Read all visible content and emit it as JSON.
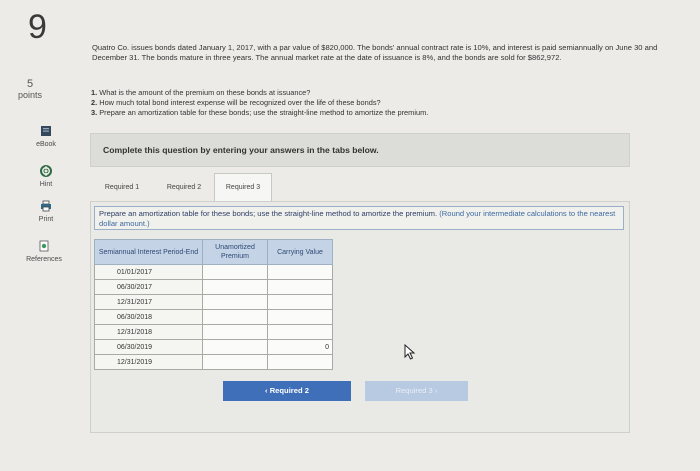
{
  "question_number": "9",
  "points": {
    "value": "5",
    "label": "points"
  },
  "tools": [
    {
      "name": "ebook",
      "label": "eBook",
      "icon": "book-icon"
    },
    {
      "name": "hint",
      "label": "Hint",
      "icon": "lifebuoy-icon"
    },
    {
      "name": "print",
      "label": "Print",
      "icon": "printer-icon"
    },
    {
      "name": "references",
      "label": "References",
      "icon": "references-icon"
    }
  ],
  "problem": {
    "text": "Quatro Co. issues bonds dated January 1, 2017, with a par value of $820,000. The bonds' annual contract rate is 10%, and interest is paid semiannually on June 30 and December 31. The bonds mature in three years. The annual market rate at the date of issuance is 8%, and the bonds are sold for $862,972.",
    "questions": [
      {
        "num": "1.",
        "text": "What is the amount of the premium on these bonds at issuance?"
      },
      {
        "num": "2.",
        "text": "How much total bond interest expense will be recognized over the life of these bonds?"
      },
      {
        "num": "3.",
        "text": "Prepare an amortization table for these bonds; use the straight-line method to amortize the premium."
      }
    ]
  },
  "banner": "Complete this question by entering your answers in the tabs below.",
  "tabs": [
    {
      "label": "Required 1",
      "active": false
    },
    {
      "label": "Required 2",
      "active": false
    },
    {
      "label": "Required 3",
      "active": true
    }
  ],
  "instruction": {
    "main": "Prepare an amortization table for these bonds; use the straight-line method to amortize the premium.",
    "note": "(Round your intermediate calculations to the nearest dollar amount.)"
  },
  "table": {
    "headers": [
      "Semiannual Interest Period-End",
      "Unamortized Premium",
      "Carrying Value"
    ],
    "rows": [
      {
        "date": "01/01/2017",
        "premium": "",
        "carrying": ""
      },
      {
        "date": "06/30/2017",
        "premium": "",
        "carrying": ""
      },
      {
        "date": "12/31/2017",
        "premium": "",
        "carrying": ""
      },
      {
        "date": "06/30/2018",
        "premium": "",
        "carrying": ""
      },
      {
        "date": "12/31/2018",
        "premium": "",
        "carrying": ""
      },
      {
        "date": "06/30/2019",
        "premium": "",
        "carrying": "0"
      },
      {
        "date": "12/31/2019",
        "premium": "",
        "carrying": ""
      }
    ]
  },
  "nav": {
    "prev_label": "Required 2",
    "next_label": "Required 3"
  },
  "colors": {
    "accent": "#3f6fb8",
    "header_bg": "#c4d3e6",
    "disabled_button": "#b8c9e2"
  }
}
